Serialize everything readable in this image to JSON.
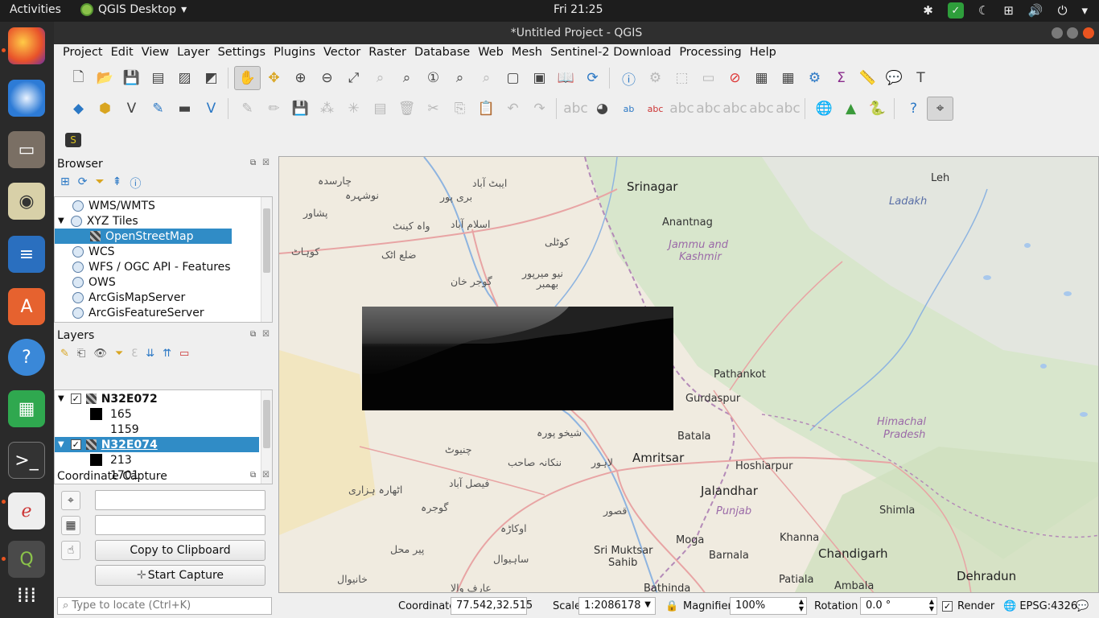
{
  "topbar": {
    "activities": "Activities",
    "app_name": "QGIS Desktop",
    "clock": "Fri 21:25"
  },
  "window": {
    "title": "*Untitled Project - QGIS"
  },
  "menubar": [
    "Project",
    "Edit",
    "View",
    "Layer",
    "Settings",
    "Plugins",
    "Vector",
    "Raster",
    "Database",
    "Web",
    "Mesh",
    "Sentinel-2 Download",
    "Processing",
    "Help"
  ],
  "browser": {
    "title": "Browser",
    "items": [
      {
        "label": "WMS/WMTS",
        "icon": "globe-icon"
      },
      {
        "label": "XYZ Tiles",
        "icon": "globe-icon"
      },
      {
        "label": "OpenStreetMap",
        "icon": "xyz-tile-icon"
      },
      {
        "label": "WCS",
        "icon": "globe-icon"
      },
      {
        "label": "WFS / OGC API - Features",
        "icon": "globe-icon"
      },
      {
        "label": "OWS",
        "icon": "globe-icon"
      },
      {
        "label": "ArcGisMapServer",
        "icon": "globe-icon"
      },
      {
        "label": "ArcGisFeatureServer",
        "icon": "globe-icon"
      }
    ]
  },
  "layers": {
    "title": "Layers",
    "items": [
      {
        "name": "N32E072",
        "min": "165",
        "max": "1159"
      },
      {
        "name": "N32E074",
        "min": "213",
        "max": "1701"
      }
    ]
  },
  "coordinate_capture": {
    "title": "Coordinate Capture",
    "field1": "",
    "field2": "",
    "copy_button": "Copy to Clipboard",
    "start_button": "Start Capture"
  },
  "statusbar": {
    "locate_placeholder": "Type to locate (Ctrl+K)",
    "coordinate_label": "Coordinate",
    "coordinate_value": "77.542,32.515",
    "scale_label": "Scale",
    "scale_value": "1:2086178",
    "magnifier_label": "Magnifier",
    "magnifier_value": "100%",
    "rotation_label": "Rotation",
    "rotation_value": "0.0 °",
    "render_label": "Render",
    "crs": "EPSG:4326"
  },
  "map_labels": {
    "srinagar": "Srinagar",
    "leh": "Leh",
    "ladakh": "Ladakh",
    "anantnag": "Anantnag",
    "jammu": "Jammu and",
    "kashmir": "Kashmir",
    "pathankot": "Pathankot",
    "gurdaspur": "Gurdaspur",
    "batala": "Batala",
    "amritsar": "Amritsar",
    "hoshiarpur": "Hoshiarpur",
    "himachal": "Himachal",
    "pradesh": "Pradesh",
    "jalandhar": "Jalandhar",
    "punjab": "Punjab",
    "shimla": "Shimla",
    "moga": "Moga",
    "khanna": "Khanna",
    "sri_muktsar": "Sri Muktsar",
    "sahib": "Sahib",
    "barnala": "Barnala",
    "chandigarh": "Chandigarh",
    "patiala": "Patiala",
    "ambala": "Ambala",
    "bathinda": "Bathinda",
    "dehradun": "Dehradun",
    "u_islamabad": "اسلام آباد",
    "u_peshawar": "پشاور",
    "u_nowshera": "نوشہرہ",
    "u_charsadda": "چارسدہ",
    "u_kohat": "کوہاٹ",
    "u_attock": "ضلع اٹک",
    "u_gujarkhan": "گوجر خان",
    "u_kotli": "کوٹلی",
    "u_mirpur": "نیو میرپور",
    "u_bhimber": "بھمبر",
    "u_wahcantt": "واہ کینٹ",
    "u_abbottabad": "ایبٹ آباد",
    "u_haripur": "ہری پور",
    "u_berripur": "بری پور",
    "u_sheikhupura": "شیخو پورہ",
    "u_chiniot": "چنیوٹ",
    "u_nankana": "ننکانہ صاحب",
    "u_lahore": "لاہور",
    "u_faisalabad": "فیصل آباد",
    "u_athara": "اٹھارہ ہزاری",
    "u_gojra": "گوجرہ",
    "u_kasur": "قصور",
    "u_okara": "اوکاڑہ",
    "u_pirmahal": "پیر محل",
    "u_sahiwal": "ساہیوال",
    "u_khanewal": "خانیوال",
    "u_arifwala": "عارف والا"
  }
}
